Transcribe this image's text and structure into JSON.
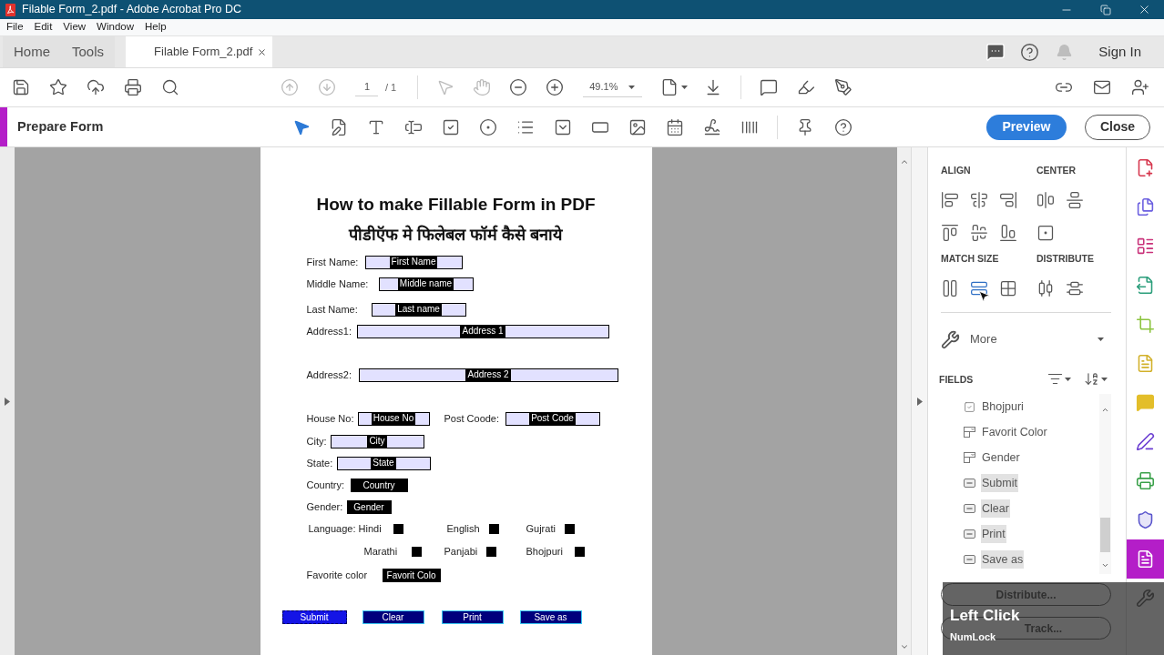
{
  "window": {
    "title": "Filable Form_2.pdf - Adobe Acrobat Pro DC"
  },
  "menu": [
    "File",
    "Edit",
    "View",
    "Window",
    "Help"
  ],
  "tabs": [
    {
      "label": "Home",
      "selected": false,
      "closable": false
    },
    {
      "label": "Tools",
      "selected": false,
      "closable": false
    },
    {
      "label": "Filable Form_2.pdf",
      "selected": true,
      "closable": true
    }
  ],
  "account": {
    "sign_in": "Sign In"
  },
  "toolbar": {
    "nav": [
      {
        "kind": "previous",
        "disabled": true
      },
      {
        "kind": "next",
        "disabled": true
      }
    ],
    "page": "1",
    "page_total": "/ 1",
    "view_tools": [
      {
        "kind": "select",
        "disabled": true
      },
      {
        "kind": "hand",
        "disabled": true
      },
      {
        "kind": "zoom_out",
        "disabled": false
      },
      {
        "kind": "zoom_in",
        "disabled": false
      }
    ],
    "zoom": "49.1%"
  },
  "prepare_form": {
    "title": "Prepare Form",
    "tools": [
      {
        "kind": "select",
        "selected": true
      },
      {
        "kind": "edit",
        "selected": false
      },
      {
        "kind": "text",
        "selected": false
      },
      {
        "kind": "textfield",
        "selected": false
      },
      {
        "kind": "checkbox",
        "selected": false
      },
      {
        "kind": "radio",
        "selected": false
      },
      {
        "kind": "listbox",
        "selected": false
      },
      {
        "kind": "dropdown",
        "selected": false
      },
      {
        "kind": "button",
        "selected": false
      },
      {
        "kind": "image",
        "selected": false
      },
      {
        "kind": "date",
        "selected": false
      },
      {
        "kind": "signature",
        "selected": false
      },
      {
        "kind": "barcode",
        "selected": false
      }
    ],
    "buttons": [
      {
        "label": "Preview",
        "kind": "primary"
      },
      {
        "label": "Close",
        "kind": "outline"
      }
    ]
  },
  "document": {
    "title": "How to make Fillable Form in PDF",
    "subtitle": "पीडीऍफ मे फिलेबल फॉर्म कैसे बनाये",
    "rows": [
      {
        "items": [
          {
            "kind": "label",
            "text": "First Name:"
          },
          {
            "kind": "text_field",
            "text": "First Name"
          }
        ]
      },
      {
        "items": [
          {
            "kind": "label",
            "text": "Middle Name:"
          },
          {
            "kind": "text_field",
            "text": "Middle name"
          }
        ]
      },
      {
        "items": [
          {
            "kind": "label",
            "text": "Last Name:"
          },
          {
            "kind": "text_field",
            "text": "Last name"
          }
        ]
      },
      {
        "items": [
          {
            "kind": "label",
            "text": "Address1:"
          },
          {
            "kind": "text_field",
            "text": "Address 1"
          }
        ]
      },
      {
        "items": [
          {
            "kind": "label",
            "text": "Address2:"
          },
          {
            "kind": "text_field",
            "text": "Address 2"
          }
        ]
      },
      {
        "items": [
          {
            "kind": "label",
            "text": "House No:"
          },
          {
            "kind": "text_field",
            "text": "House No"
          },
          {
            "kind": "label",
            "text": "Post Coode:"
          },
          {
            "kind": "text_field",
            "text": "Post Code"
          }
        ]
      },
      {
        "items": [
          {
            "kind": "label",
            "text": "City:"
          },
          {
            "kind": "text_field",
            "text": "City"
          }
        ]
      },
      {
        "items": [
          {
            "kind": "label",
            "text": "State:"
          },
          {
            "kind": "text_field",
            "text": "State"
          }
        ]
      },
      {
        "items": [
          {
            "kind": "label",
            "text": "Country:"
          },
          {
            "kind": "dropdown_field",
            "text": "Country"
          }
        ]
      },
      {
        "items": [
          {
            "kind": "label",
            "text": "Gender:"
          },
          {
            "kind": "dropdown_field",
            "text": "Gender"
          }
        ]
      },
      {
        "items": [
          {
            "kind": "label",
            "text": "Language: Hindi"
          },
          {
            "kind": "checkbox_field"
          },
          {
            "kind": "label",
            "text": "English"
          },
          {
            "kind": "checkbox_field"
          },
          {
            "kind": "label",
            "text": "Gujrati"
          },
          {
            "kind": "checkbox_field"
          }
        ]
      },
      {
        "items": [
          {
            "kind": "label",
            "text": "Marathi"
          },
          {
            "kind": "checkbox_field"
          },
          {
            "kind": "label",
            "text": "Panjabi"
          },
          {
            "kind": "checkbox_field"
          },
          {
            "kind": "label",
            "text": "Bhojpuri"
          },
          {
            "kind": "checkbox_field"
          }
        ]
      },
      {
        "items": [
          {
            "kind": "label",
            "text": "Favorite color"
          },
          {
            "kind": "dropdown_field",
            "text": "Favorit Colo"
          }
        ]
      }
    ],
    "buttons": [
      {
        "label": "Submit",
        "selected": true
      },
      {
        "label": "Clear",
        "selected": false
      },
      {
        "label": "Print",
        "selected": false
      },
      {
        "label": "Save as",
        "selected": false
      }
    ]
  },
  "panel": {
    "groups": [
      {
        "title": "ALIGN",
        "tools": [
          {
            "kind": "left",
            "hovered": false
          },
          {
            "kind": "hcenter",
            "hovered": false
          },
          {
            "kind": "right",
            "hovered": false
          },
          {
            "kind": "top",
            "hovered": false
          },
          {
            "kind": "middle",
            "hovered": false
          },
          {
            "kind": "bottom",
            "hovered": false
          }
        ]
      },
      {
        "title": "CENTER",
        "tools": [
          {
            "kind": "horizontal",
            "hovered": false
          },
          {
            "kind": "vertical",
            "hovered": false
          },
          {
            "kind": "both",
            "hovered": false
          }
        ]
      },
      {
        "title": "MATCH SIZE",
        "tools": [
          {
            "kind": "width",
            "hovered": false
          },
          {
            "kind": "height",
            "hovered": true
          },
          {
            "kind": "size",
            "hovered": false
          }
        ]
      },
      {
        "title": "DISTRIBUTE",
        "tools": [
          {
            "kind": "hspace",
            "hovered": false
          },
          {
            "kind": "vspace",
            "hovered": false
          }
        ]
      }
    ],
    "more": "More",
    "fields_title": "FIELDS",
    "fields": [
      {
        "name": "Bhojpuri",
        "kind": "checkbox",
        "selected": false
      },
      {
        "name": "Favorit Color",
        "kind": "dropdown",
        "selected": false
      },
      {
        "name": "Gender",
        "kind": "dropdown",
        "selected": false
      },
      {
        "name": "Submit",
        "kind": "button",
        "selected": true
      },
      {
        "name": "Clear",
        "kind": "button",
        "selected": true
      },
      {
        "name": "Print",
        "kind": "button",
        "selected": true
      },
      {
        "name": "Save as",
        "kind": "button",
        "selected": true
      }
    ],
    "buttons": [
      "Distribute...",
      "Track..."
    ]
  },
  "rail": [
    {
      "kind": "create",
      "selected": false
    },
    {
      "kind": "combine",
      "selected": false
    },
    {
      "kind": "organize",
      "selected": false
    },
    {
      "kind": "export",
      "selected": false
    },
    {
      "kind": "crop",
      "selected": false
    },
    {
      "kind": "enhance",
      "selected": false
    },
    {
      "kind": "comment",
      "selected": false
    },
    {
      "kind": "sign",
      "selected": false
    },
    {
      "kind": "print",
      "selected": false
    },
    {
      "kind": "protect",
      "selected": false
    },
    {
      "kind": "form",
      "selected": true
    },
    {
      "kind": "tools",
      "selected": false
    }
  ],
  "key_overlay": {
    "key": "Left Click",
    "lock": "NumLock"
  }
}
